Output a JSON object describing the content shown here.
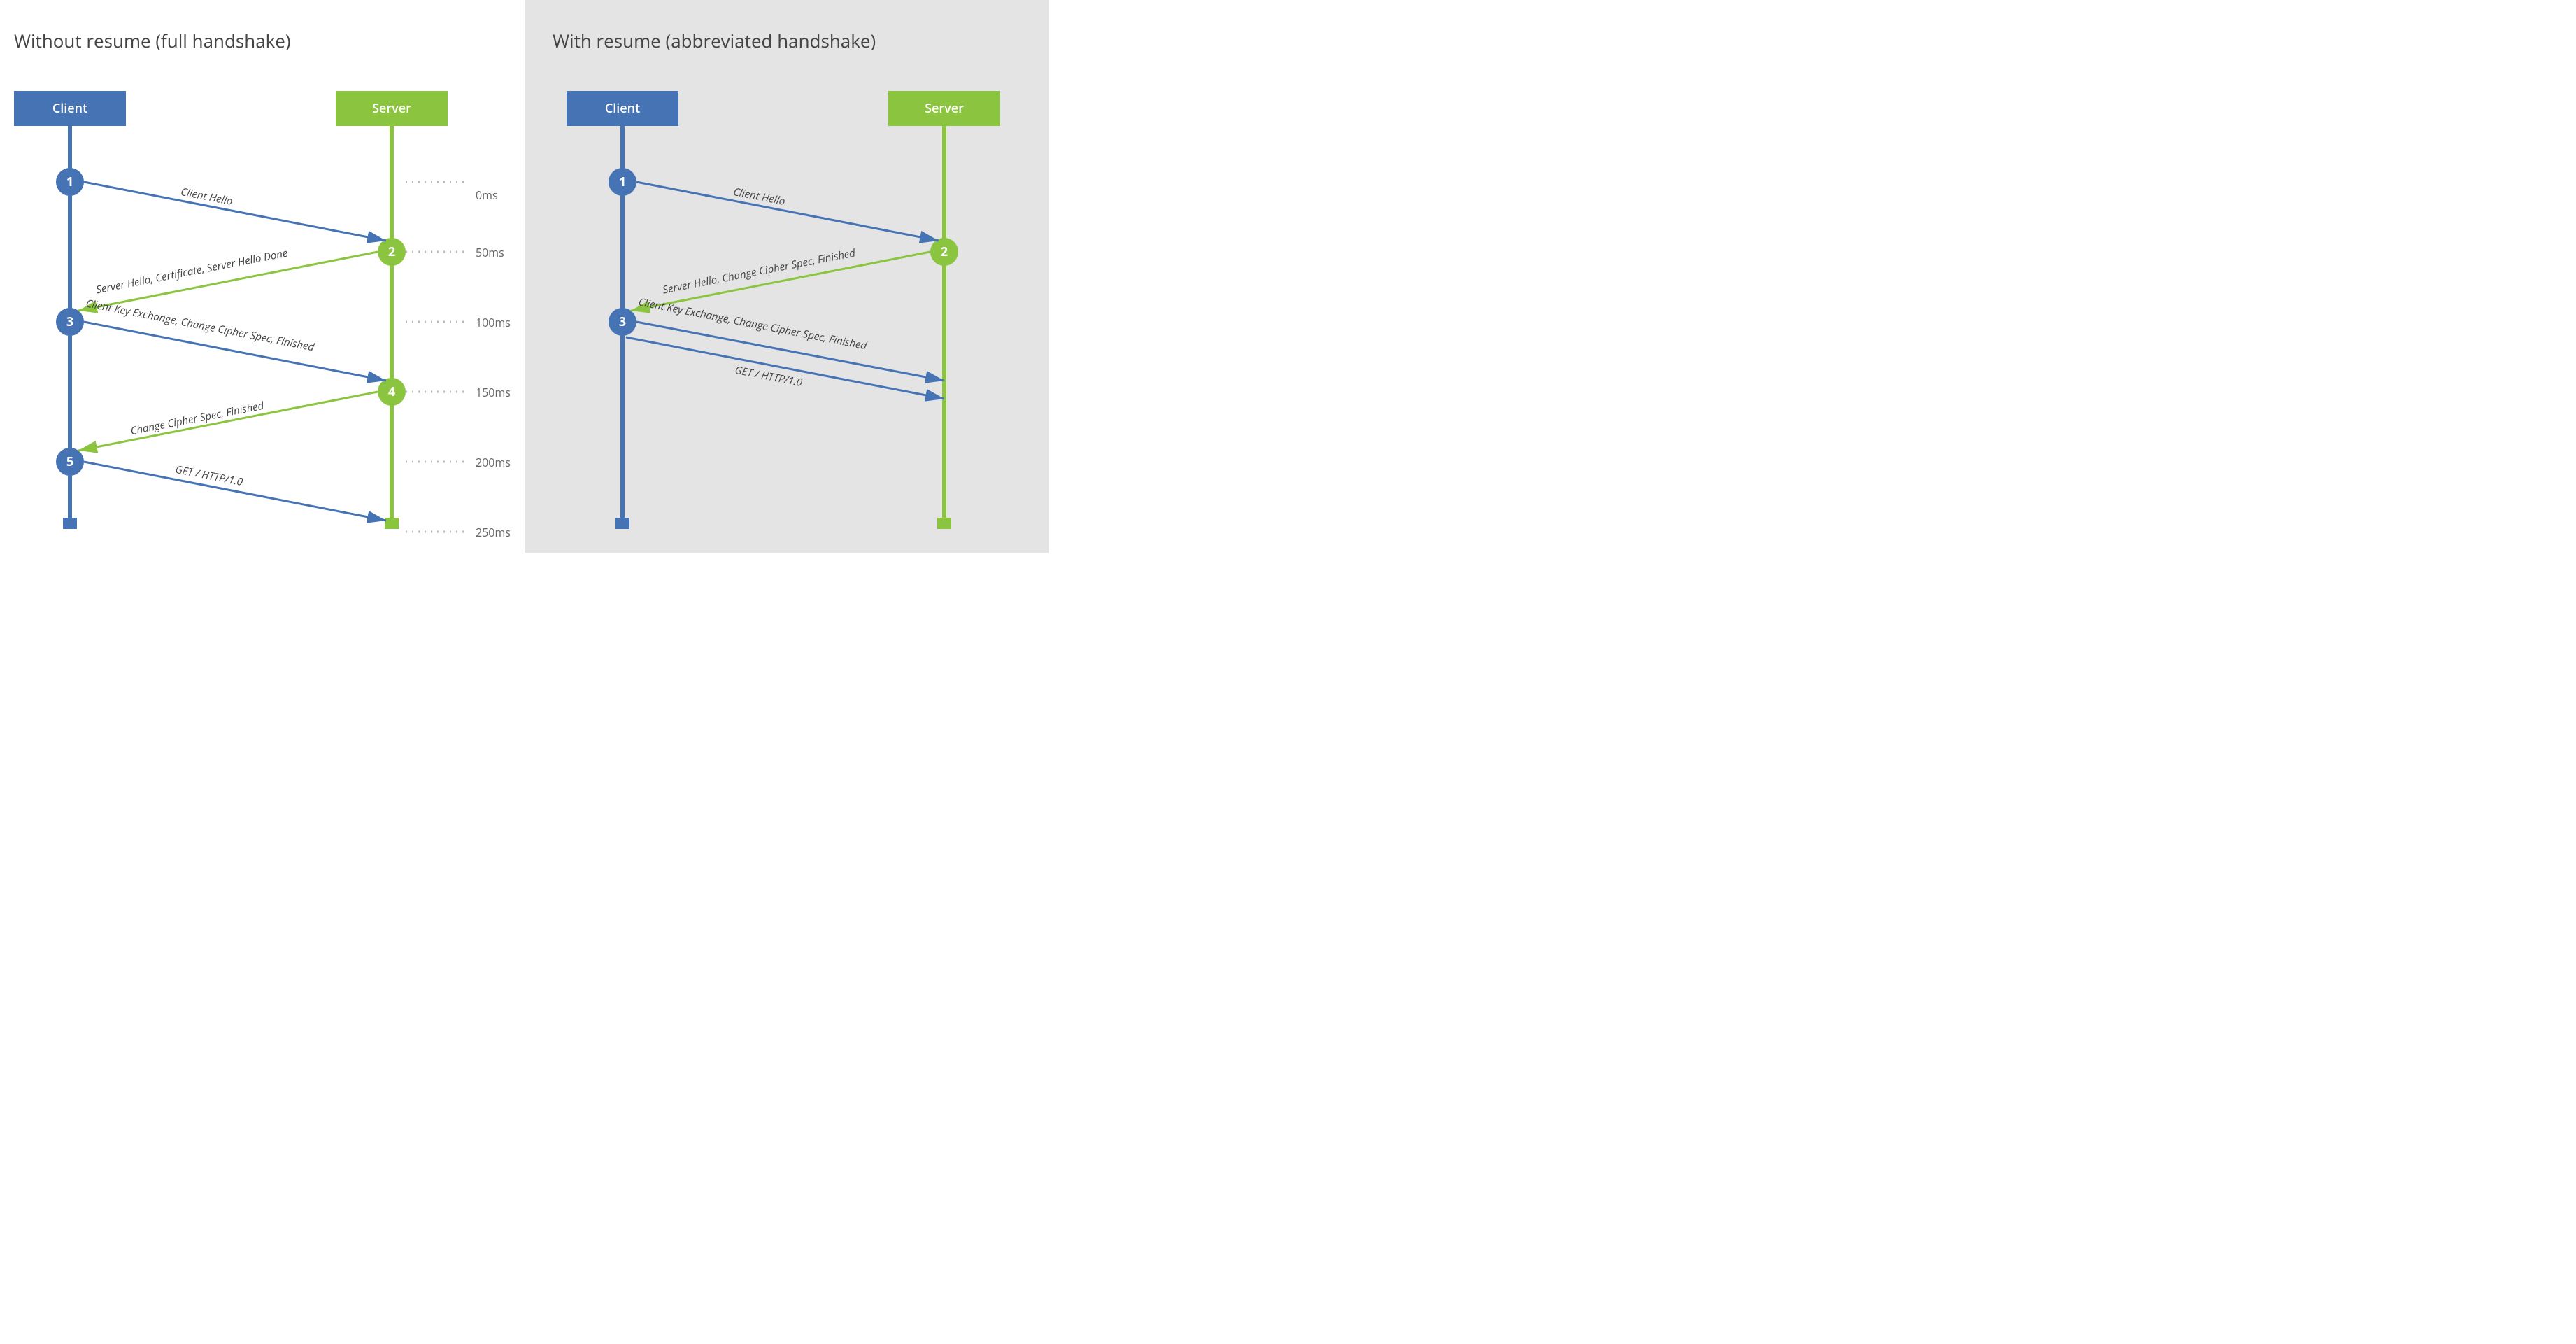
{
  "colors": {
    "client": "#4573B4",
    "server": "#8BC53F",
    "dot": "#BBBBBB",
    "text": "#444"
  },
  "actors": {
    "client": "Client",
    "server": "Server"
  },
  "times": [
    "0ms",
    "50ms",
    "100ms",
    "150ms",
    "200ms",
    "250ms"
  ],
  "left": {
    "title": "Without resume (full handshake)",
    "steps": [
      {
        "n": "1",
        "side": "client"
      },
      {
        "n": "2",
        "side": "server"
      },
      {
        "n": "3",
        "side": "client"
      },
      {
        "n": "4",
        "side": "server"
      },
      {
        "n": "5",
        "side": "client"
      }
    ],
    "messages": [
      "Client Hello",
      "Server Hello, Certificate, Server Hello Done",
      "Client Key Exchange, Change Cipher Spec, Finished",
      "Change Cipher Spec, Finished",
      "GET / HTTP/1.0"
    ]
  },
  "right": {
    "title": "With resume (abbreviated handshake)",
    "steps": [
      {
        "n": "1",
        "side": "client"
      },
      {
        "n": "2",
        "side": "server"
      },
      {
        "n": "3",
        "side": "client"
      }
    ],
    "messages": [
      "Client Hello",
      "Server Hello, Change Cipher Spec, Finished",
      "Client Key Exchange, Change Cipher Spec, Finished",
      "GET / HTTP/1.0"
    ]
  }
}
